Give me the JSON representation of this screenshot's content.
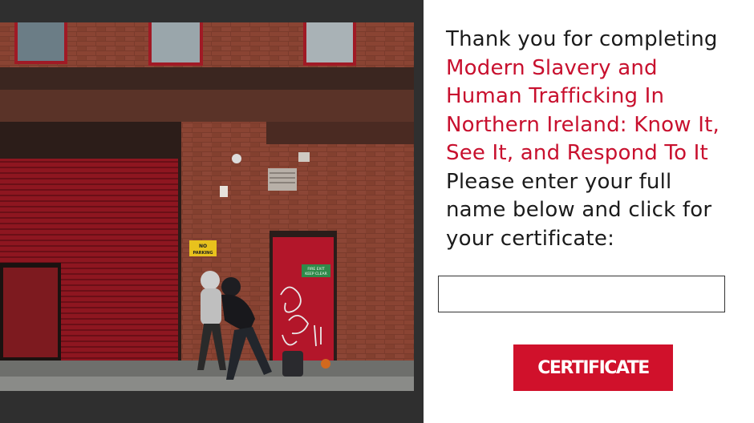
{
  "photo": {
    "sign_no_parking": "NO PARKING",
    "sign_fire_exit": "FIRE EXIT KEEP CLEAR"
  },
  "message": {
    "intro": "Thank you for completing",
    "course_lines": [
      "Modern Slavery and",
      "Human Trafficking In",
      "Northern Ireland: Know It,",
      "See It, and Respond To It"
    ],
    "instruction_lines": [
      "Please enter your full",
      "name below and click for",
      "your certificate:"
    ]
  },
  "name_input": {
    "value": "",
    "placeholder": ""
  },
  "certificate_button": {
    "label": "CERTIFICATE"
  },
  "colors": {
    "accent": "#c8102e",
    "button": "#d0112b",
    "text": "#1b1b1b",
    "frame": "#2f2f2f"
  }
}
